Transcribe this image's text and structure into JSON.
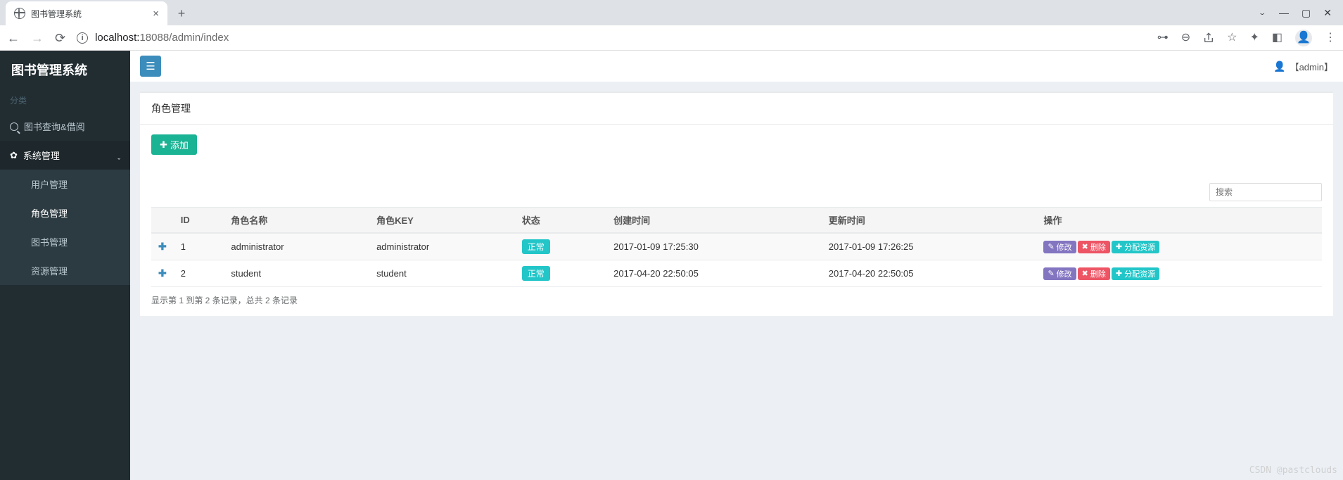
{
  "browser": {
    "tab_title": "图书管理系统",
    "url_host": "localhost:",
    "url_port_path": "18088/admin/index"
  },
  "brand": "图书管理系统",
  "sidebar": {
    "section": "分类",
    "items": [
      {
        "label": "图书查询&借阅"
      },
      {
        "label": "系统管理",
        "children": [
          {
            "label": "用户管理"
          },
          {
            "label": "角色管理"
          },
          {
            "label": "图书管理"
          },
          {
            "label": "资源管理"
          }
        ]
      }
    ]
  },
  "header": {
    "user_display": "【admin】"
  },
  "panel": {
    "title": "角色管理",
    "add_label": "添加",
    "search_placeholder": "搜索",
    "columns": {
      "id": "ID",
      "name": "角色名称",
      "key": "角色KEY",
      "status": "状态",
      "created": "创建时间",
      "updated": "更新时间",
      "ops": "操作"
    },
    "rows": [
      {
        "id": "1",
        "name": "administrator",
        "key": "administrator",
        "status": "正常",
        "created": "2017-01-09 17:25:30",
        "updated": "2017-01-09 17:26:25"
      },
      {
        "id": "2",
        "name": "student",
        "key": "student",
        "status": "正常",
        "created": "2017-04-20 22:50:05",
        "updated": "2017-04-20 22:50:05"
      }
    ],
    "actions": {
      "edit": "修改",
      "delete": "删除",
      "assign": "分配资源"
    },
    "info": "显示第 1 到第 2 条记录，总共 2 条记录"
  },
  "watermark": "CSDN @pastclouds"
}
